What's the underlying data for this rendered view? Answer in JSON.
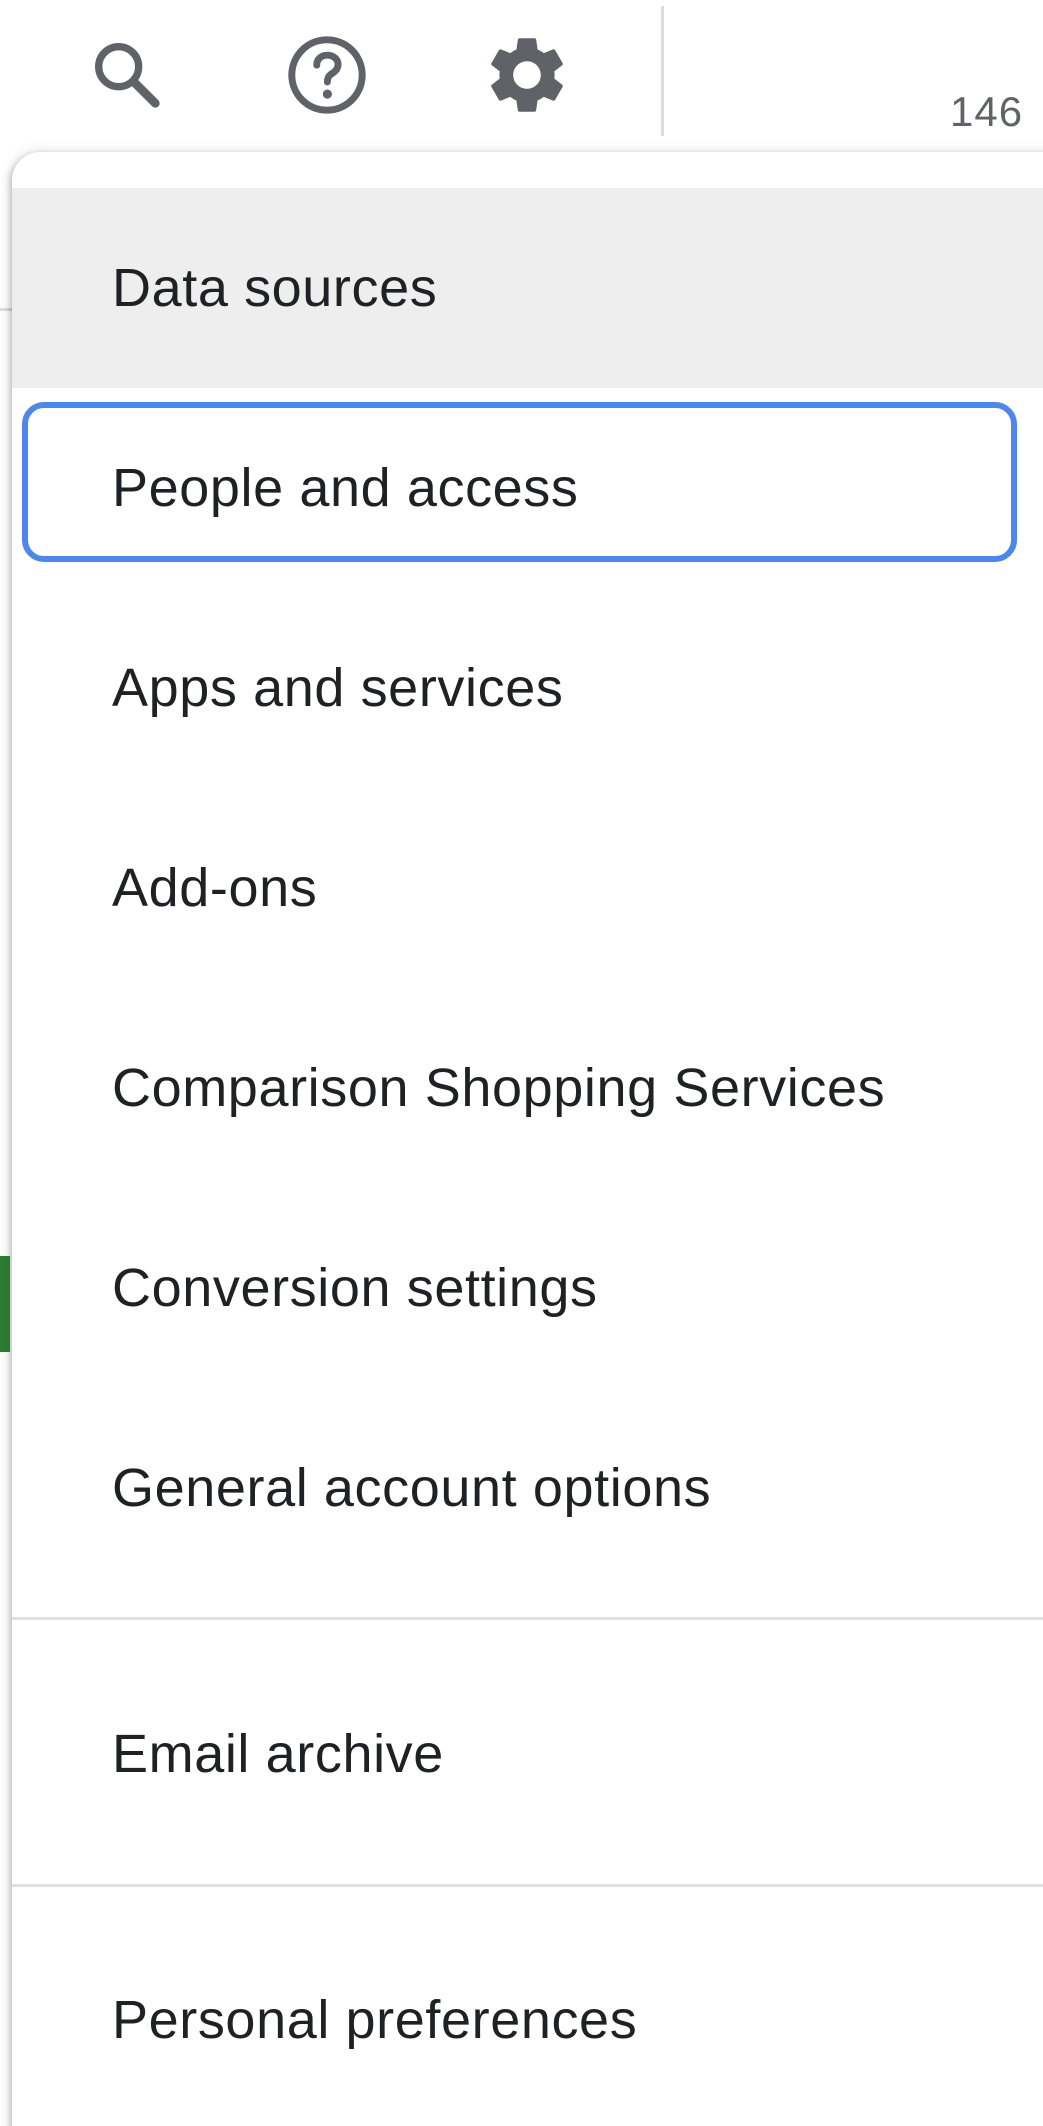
{
  "topbar": {
    "icons": {
      "search": "search-icon",
      "help": "help-icon",
      "settings": "gear-icon"
    },
    "account_id_partial": "146"
  },
  "menu": {
    "items": [
      {
        "label": "Data sources",
        "state": "hovered"
      },
      {
        "label": "People and access",
        "state": "focused"
      },
      {
        "label": "Apps and services"
      },
      {
        "label": "Add-ons"
      },
      {
        "label": "Comparison Shopping Services"
      },
      {
        "label": "Conversion settings"
      },
      {
        "label": "General account options"
      },
      {
        "label": "Email archive"
      },
      {
        "label": "Personal preferences"
      }
    ]
  },
  "colors": {
    "focus_ring": "#4f86ec",
    "hover_bg": "#eeeeee",
    "icon": "#5f6368",
    "text": "#202124",
    "status_green": "#2e7d32"
  }
}
